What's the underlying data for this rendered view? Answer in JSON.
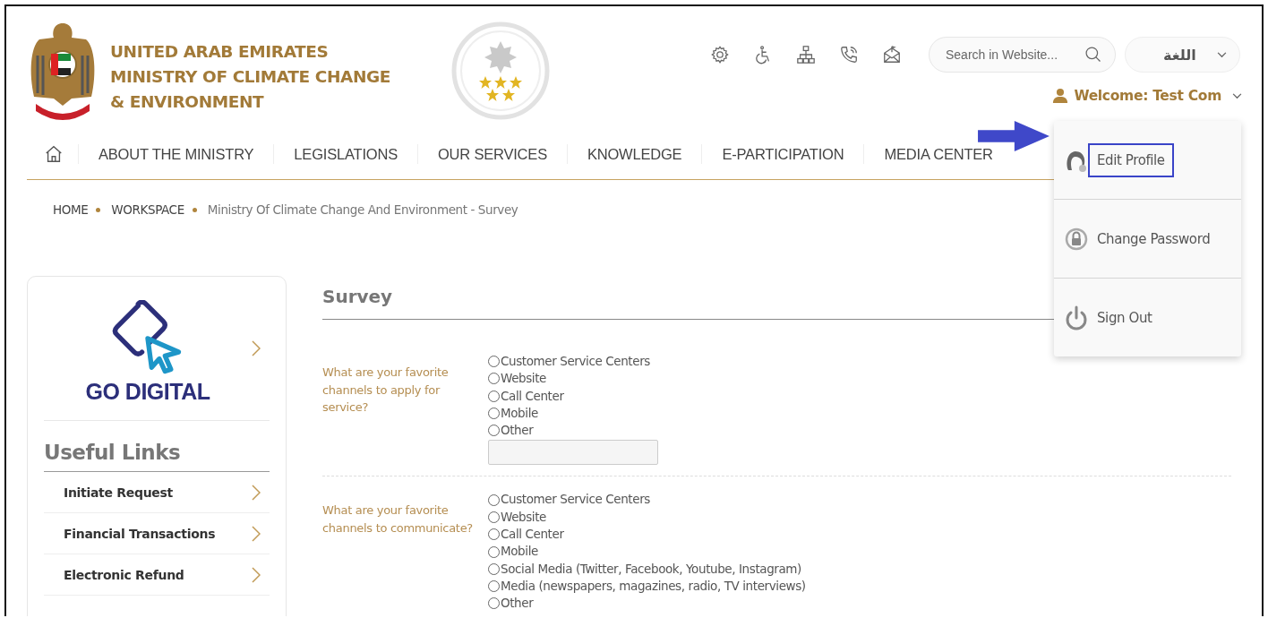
{
  "header": {
    "org_lines": [
      "UNITED ARAB EMIRATES",
      "MINISTRY OF CLIMATE CHANGE",
      "& ENVIRONMENT"
    ],
    "tools": [
      {
        "kind": "settings"
      },
      {
        "kind": "accessibility"
      },
      {
        "kind": "sitemap"
      },
      {
        "kind": "phone"
      },
      {
        "kind": "mail"
      }
    ],
    "search": {
      "placeholder": "Search in Website..."
    },
    "language": "اللغة",
    "welcome": "Welcome: Test Com"
  },
  "user_menu": [
    {
      "kind": "profile",
      "label": "Edit Profile",
      "highlighted": true
    },
    {
      "kind": "password",
      "label": "Change Password",
      "highlighted": false
    },
    {
      "kind": "signout",
      "label": "Sign Out",
      "highlighted": false
    }
  ],
  "nav": [
    "ABOUT THE MINISTRY",
    "LEGISLATIONS",
    "OUR SERVICES",
    "KNOWLEDGE",
    "E-PARTICIPATION",
    "MEDIA CENTER"
  ],
  "breadcrumb": [
    "HOME",
    "WORKSPACE",
    "Ministry Of Climate Change And Environment - Survey"
  ],
  "sidebar": {
    "banner": "GO DIGITAL",
    "title": "Useful Links",
    "links": [
      "Initiate Request",
      "Financial Transactions",
      "Electronic Refund"
    ]
  },
  "survey": {
    "title": "Survey",
    "questions": [
      {
        "label": "What are your favorite channels to apply for service?",
        "text_field": true,
        "options": [
          {
            "label": "Customer Service Centers",
            "selected": false
          },
          {
            "label": "Website",
            "selected": false
          },
          {
            "label": "Call Center",
            "selected": false
          },
          {
            "label": "Mobile",
            "selected": false
          },
          {
            "label": "Other",
            "selected": false
          }
        ]
      },
      {
        "label": "What are your favorite channels to communicate?",
        "text_field": false,
        "options": [
          {
            "label": "Customer Service Centers",
            "selected": false
          },
          {
            "label": "Website",
            "selected": false
          },
          {
            "label": "Call Center",
            "selected": false
          },
          {
            "label": "Mobile",
            "selected": false
          },
          {
            "label": "Social Media (Twitter, Facebook, Youtube, Instagram)",
            "selected": false
          },
          {
            "label": "Media (newspapers, magazines, radio, TV interviews)",
            "selected": false
          },
          {
            "label": "Other",
            "selected": false
          }
        ]
      }
    ]
  }
}
